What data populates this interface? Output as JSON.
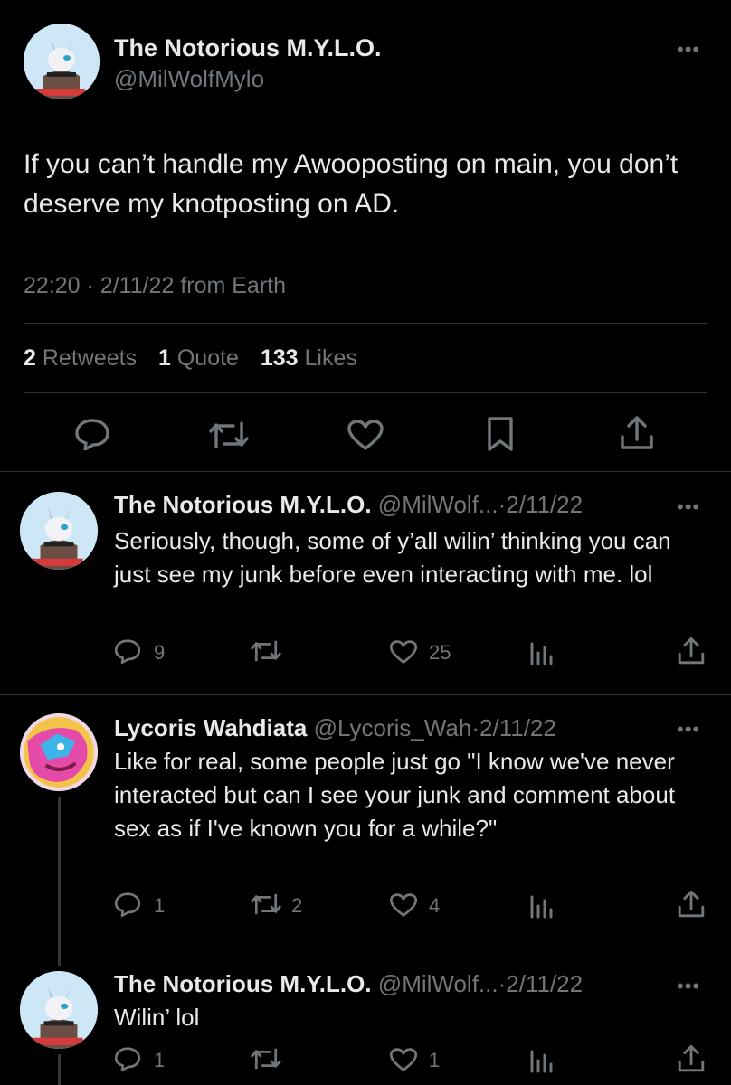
{
  "main_tweet": {
    "author_name": "The Notorious M.Y.L.O.",
    "handle": "@MilWolfMylo",
    "text": "If you can’t handle my Awooposting on main, you don’t deserve my knotposting on AD.",
    "time": "22:20",
    "date": "2/11/22",
    "source": "from Earth",
    "stats": {
      "retweets_count": "2",
      "retweets_label": "Retweets",
      "quotes_count": "1",
      "quotes_label": "Quote",
      "likes_count": "133",
      "likes_label": "Likes"
    }
  },
  "replies": [
    {
      "author_name": "The Notorious M.Y.L.O.",
      "handle": "@MilWolf...",
      "date": "2/11/22",
      "text": "Seriously, though, some of y’all wilin’ thinking you can just see my junk before even interacting with me. lol",
      "replies": "9",
      "retweets": "",
      "likes": "25"
    },
    {
      "author_name": "Lycoris Wahdiata",
      "handle": "@Lycoris_Wah",
      "date": "2/11/22",
      "text": "Like for real, some people just go \"I know we've never interacted but can I see your junk and comment about sex as if I've known you for a while?\"",
      "replies": "1",
      "retweets": "2",
      "likes": "4"
    },
    {
      "author_name": "The Notorious M.Y.L.O.",
      "handle": "@MilWolf...",
      "date": "2/11/22",
      "text": "Wilin’ lol",
      "replies": "1",
      "retweets": "",
      "likes": "1"
    }
  ],
  "separator": "·",
  "more_glyph": "•••",
  "colors": {
    "background": "#000000",
    "text": "#e7e9ea",
    "muted": "#71767b",
    "divider": "#2f3336"
  },
  "icons": [
    "reply-icon",
    "retweet-icon",
    "like-icon",
    "bookmark-icon",
    "share-icon",
    "views-icon",
    "more-icon"
  ]
}
